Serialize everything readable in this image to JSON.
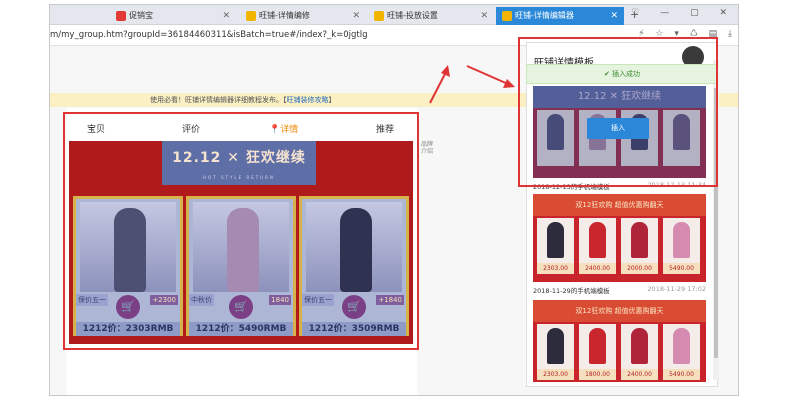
{
  "browser": {
    "tabs": [
      {
        "label": "促销宝",
        "fav_color": "#e53935",
        "active": false
      },
      {
        "label": "旺铺-详情编修",
        "fav_color": "#f2b400",
        "active": false
      },
      {
        "label": "旺铺-投放设置",
        "fav_color": "#f2b400",
        "active": false
      },
      {
        "label": "旺铺-详情编辑器",
        "fav_color": "#f2b400",
        "active": true
      }
    ],
    "new_tab": "+",
    "window_controls": "♡ — ▢ ✕",
    "url": "m/my_group.htm?groupId=36184460311&isBatch=true#/index?_k=0jgtlg",
    "toolbar_icons": "⚡ ☆ ▾ ♺ ▤ ⤓"
  },
  "notice": {
    "text": "使用必看！旺铺详情编辑器详细教程发布。【",
    "link": "旺铺装修攻略",
    "close": "】"
  },
  "editor": {
    "tabs": [
      {
        "label": "宝贝",
        "active": false
      },
      {
        "label": "评价",
        "active": false
      },
      {
        "label": "详情",
        "active": true
      },
      {
        "label": "推荐",
        "active": false
      }
    ],
    "side_label": "品牌介绍",
    "banner": {
      "title": "12.12 ✕ 狂欢继续",
      "subtitle": "HOT STYLE RETURN",
      "products": [
        {
          "tag": "保价五一",
          "tag_num": "+2300",
          "price": "1212价：2303RMB"
        },
        {
          "tag": "中秋价",
          "tag_num": "1840",
          "price": "1212价：5490RMB"
        },
        {
          "tag": "保价五一",
          "tag_num": "+1840",
          "price": "1212价：3509RMB"
        }
      ]
    }
  },
  "template_panel": {
    "title": "旺铺详情模板",
    "toast": "插入成功",
    "insert_button": "插入",
    "cards": [
      {
        "head": "12.12 ✕ 狂欢继续",
        "label": "2018-12-13的手机端模板",
        "date": "2018-12-13 11:34",
        "prices": [
          "",
          "",
          "",
          ""
        ]
      },
      {
        "head": "双12狂欢购 超值优惠购翻天",
        "label": "2018-11-29的手机端模板",
        "date": "2018-11-29 17:02",
        "prices": [
          "2303.00",
          "2400.00",
          "2000.00",
          "5490.00"
        ]
      },
      {
        "head": "双12狂欢购 超值优惠购翻天",
        "label": "",
        "date": "",
        "prices": [
          "2303.00",
          "1800.00",
          "2400.00",
          "5490.00"
        ]
      }
    ]
  },
  "colors": {
    "accent": "#2b88d8",
    "highlight_red": "#e03434",
    "active_tab_orange": "#f08a00",
    "banner_red": "#b01a1a",
    "toast_green": "#3c8c30"
  }
}
